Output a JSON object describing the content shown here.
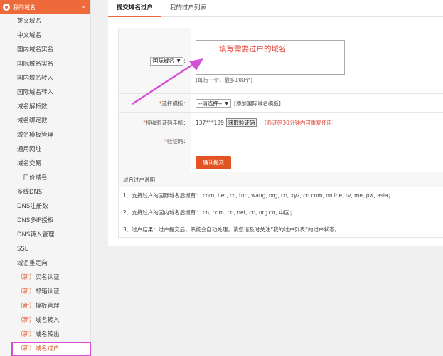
{
  "sidebar": {
    "title": "我的域名",
    "chevron": "⌄",
    "items": [
      {
        "new": "",
        "label": "英文域名"
      },
      {
        "new": "",
        "label": "中文域名"
      },
      {
        "new": "",
        "label": "国内域名实名"
      },
      {
        "new": "",
        "label": "国际域名实名"
      },
      {
        "new": "",
        "label": "国内域名转入"
      },
      {
        "new": "",
        "label": "国际域名转入"
      },
      {
        "new": "",
        "label": "域名解析数"
      },
      {
        "new": "",
        "label": "域名绑定数"
      },
      {
        "new": "",
        "label": "域名模板管理"
      },
      {
        "new": "",
        "label": "通用网址"
      },
      {
        "new": "",
        "label": "域名交易"
      },
      {
        "new": "",
        "label": "一口价域名"
      },
      {
        "new": "",
        "label": "多线DNS"
      },
      {
        "new": "",
        "label": "DNS注册数"
      },
      {
        "new": "",
        "label": "DNS多IP授权"
      },
      {
        "new": "",
        "label": "DNS转入管理"
      },
      {
        "new": "",
        "label": "SSL"
      },
      {
        "new": "",
        "label": "域名重定向"
      },
      {
        "new": "（新）",
        "label": "实名认证"
      },
      {
        "new": "（新）",
        "label": "邮箱认证"
      },
      {
        "new": "（新）",
        "label": "模板管理"
      },
      {
        "new": "（新）",
        "label": "域名转入"
      },
      {
        "new": "（新）",
        "label": "域名转出"
      },
      {
        "new": "（新）",
        "label": "域名过户"
      }
    ]
  },
  "tabs": [
    "提交域名过户",
    "我的过户列表"
  ],
  "form": {
    "domain_type": "国际域名",
    "colon": "：",
    "textarea_placeholder": "填写需要过户的域名",
    "hint": "(每行一个，最多100个)",
    "template_label": "选择模板：",
    "template_value": "--请选择--",
    "template_link": "[添加国际域名模板]",
    "phone_label": "接收验证码手机：",
    "phone_value": "137***139",
    "get_code": "获取验证码",
    "code_tip": "（验证码30分钟内可重复使用）",
    "code_label": "验证码：",
    "submit": "确认提交",
    "required": "*"
  },
  "notes": {
    "title": "域名过户说明",
    "items": [
      "1、支持过户的国际域名后缀有：.com,.net,.cc,.top,.wang,.org,.co,.xyz,.cn.com,.online,.tv,.me,.pw,.asia；",
      "2、支持过户的国内域名后缀有：.cn,.com..cn,.net,.cn,.org.cn,.中国；",
      "3、过户结果：过户提交后，系统会自动处理，请您请及时关注“我的过户列表”的过户状态。"
    ]
  },
  "colors": {
    "accent": "#ef6a3a",
    "annotation": "#d44fd4"
  }
}
